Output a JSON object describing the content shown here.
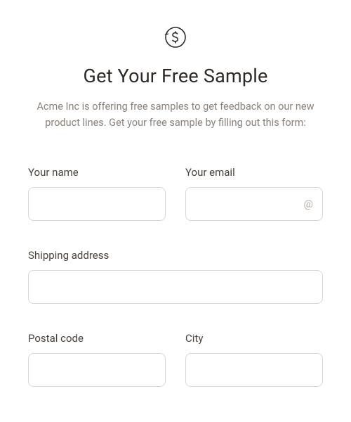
{
  "header": {
    "icon": "dollar-circle-icon",
    "title": "Get Your Free Sample",
    "subtitle": "Acme Inc is offering free samples to get feedback on our new product lines. Get your free sample by filling out this form:"
  },
  "form": {
    "name": {
      "label": "Your name",
      "value": ""
    },
    "email": {
      "label": "Your email",
      "value": "",
      "icon": "at-icon"
    },
    "address": {
      "label": "Shipping address",
      "value": ""
    },
    "postal": {
      "label": "Postal code",
      "value": ""
    },
    "city": {
      "label": "City",
      "value": ""
    }
  }
}
